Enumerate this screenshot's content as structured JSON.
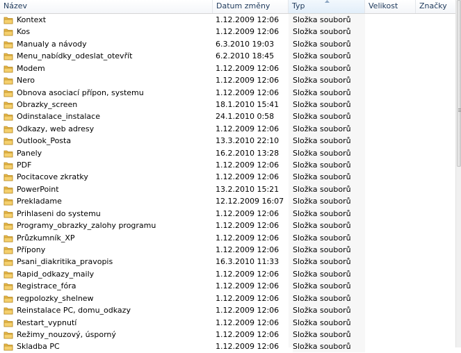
{
  "columns": {
    "name": "Název",
    "date": "Datum změny",
    "type": "Typ",
    "size": "Velikost",
    "tags": "Značky"
  },
  "sort_column": "type",
  "folder_color": "#e8b84a",
  "rows": [
    {
      "name": "Kontext",
      "date": "1.12.2009 12:06",
      "type": "Složka souborů"
    },
    {
      "name": "Kos",
      "date": "1.12.2009 12:06",
      "type": "Složka souborů"
    },
    {
      "name": "Manualy a návody",
      "date": "6.3.2010 19:03",
      "type": "Složka souborů"
    },
    {
      "name": "Menu_nabídky_odeslat_otevřít",
      "date": "6.2.2010 18:45",
      "type": "Složka souborů"
    },
    {
      "name": "Modem",
      "date": "1.12.2009 12:06",
      "type": "Složka souborů"
    },
    {
      "name": "Nero",
      "date": "1.12.2009 12:06",
      "type": "Složka souborů"
    },
    {
      "name": "Obnova asociací přípon, systemu",
      "date": "1.12.2009 12:06",
      "type": "Složka souborů"
    },
    {
      "name": "Obrazky_screen",
      "date": "18.1.2010 15:41",
      "type": "Složka souborů"
    },
    {
      "name": "Odinstalace_instalace",
      "date": "24.1.2010 0:58",
      "type": "Složka souborů"
    },
    {
      "name": "Odkazy, web adresy",
      "date": "1.12.2009 12:06",
      "type": "Složka souborů"
    },
    {
      "name": "Outlook_Posta",
      "date": "13.3.2010 22:10",
      "type": "Složka souborů"
    },
    {
      "name": "Panely",
      "date": "16.2.2010 13:28",
      "type": "Složka souborů"
    },
    {
      "name": "PDF",
      "date": "1.12.2009 12:06",
      "type": "Složka souborů"
    },
    {
      "name": "Pocitacove zkratky",
      "date": "1.12.2009 12:06",
      "type": "Složka souborů"
    },
    {
      "name": "PowerPoint",
      "date": "13.2.2010 15:21",
      "type": "Složka souborů"
    },
    {
      "name": "Prekladame",
      "date": "12.12.2009 16:07",
      "type": "Složka souborů"
    },
    {
      "name": "Prihlaseni do systemu",
      "date": "1.12.2009 12:06",
      "type": "Složka souborů"
    },
    {
      "name": "Programy_obrazky_zalohy programu",
      "date": "1.12.2009 12:06",
      "type": "Složka souborů"
    },
    {
      "name": "Průzkumník_XP",
      "date": "1.12.2009 12:06",
      "type": "Složka souborů"
    },
    {
      "name": "Přípony",
      "date": "1.12.2009 12:06",
      "type": "Složka souborů"
    },
    {
      "name": "Psani_diakritika_pravopis",
      "date": "16.3.2010 11:33",
      "type": "Složka souborů"
    },
    {
      "name": "Rapid_odkazy_maily",
      "date": "1.12.2009 12:06",
      "type": "Složka souborů"
    },
    {
      "name": "Registrace_fóra",
      "date": "1.12.2009 12:06",
      "type": "Složka souborů"
    },
    {
      "name": "regpolozky_shelnew",
      "date": "1.12.2009 12:06",
      "type": "Složka souborů"
    },
    {
      "name": "Reinstalace PC, domu_odkazy",
      "date": "1.12.2009 12:06",
      "type": "Složka souborů"
    },
    {
      "name": "Restart_vypnutí",
      "date": "1.12.2009 12:06",
      "type": "Složka souborů"
    },
    {
      "name": "Režimy_nouzový, úsporný",
      "date": "1.12.2009 12:06",
      "type": "Složka souborů"
    },
    {
      "name": "Skladba PC",
      "date": "1.12.2009 12:06",
      "type": "Složka souborů"
    }
  ]
}
